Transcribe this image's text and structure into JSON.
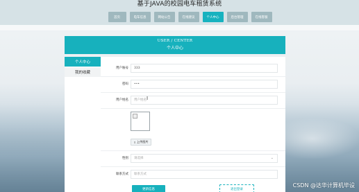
{
  "site": {
    "title": "基于JAVA的校园电车租赁系统"
  },
  "nav": {
    "items": [
      {
        "label": "首页",
        "active": false
      },
      {
        "label": "电车信息",
        "active": false
      },
      {
        "label": "网站公告",
        "active": false
      },
      {
        "label": "在线建议",
        "active": false
      },
      {
        "label": "个人中心",
        "active": true
      },
      {
        "label": "后台管理",
        "active": false
      },
      {
        "label": "在线客服",
        "active": false
      }
    ]
  },
  "banner": {
    "title_en": "USER / CENTER",
    "title_zh": "个人中心"
  },
  "sidebar": {
    "items": [
      {
        "label": "个人中心",
        "active": true
      },
      {
        "label": "我的收藏",
        "active": false
      }
    ]
  },
  "form": {
    "account_label": "用户账号",
    "account_value": "333",
    "password_label": "密码",
    "password_value": "•••",
    "name_label": "用户姓名",
    "name_placeholder": "用户姓名",
    "upload_label": "上传图片",
    "gender_label": "性别",
    "gender_value": "请选择",
    "contact_label": "联系方式",
    "contact_placeholder": "联系方式"
  },
  "buttons": {
    "save": "更新信息",
    "logout": "退出登录"
  },
  "watermark": "CSDN @达华计算机毕设",
  "colors": {
    "accent": "#17b1bd",
    "nav_inactive": "#9fb8be"
  },
  "icons": {
    "upload": "upload-icon",
    "dropdown": "chevron-down-icon",
    "cursor": "text-cursor-icon"
  }
}
